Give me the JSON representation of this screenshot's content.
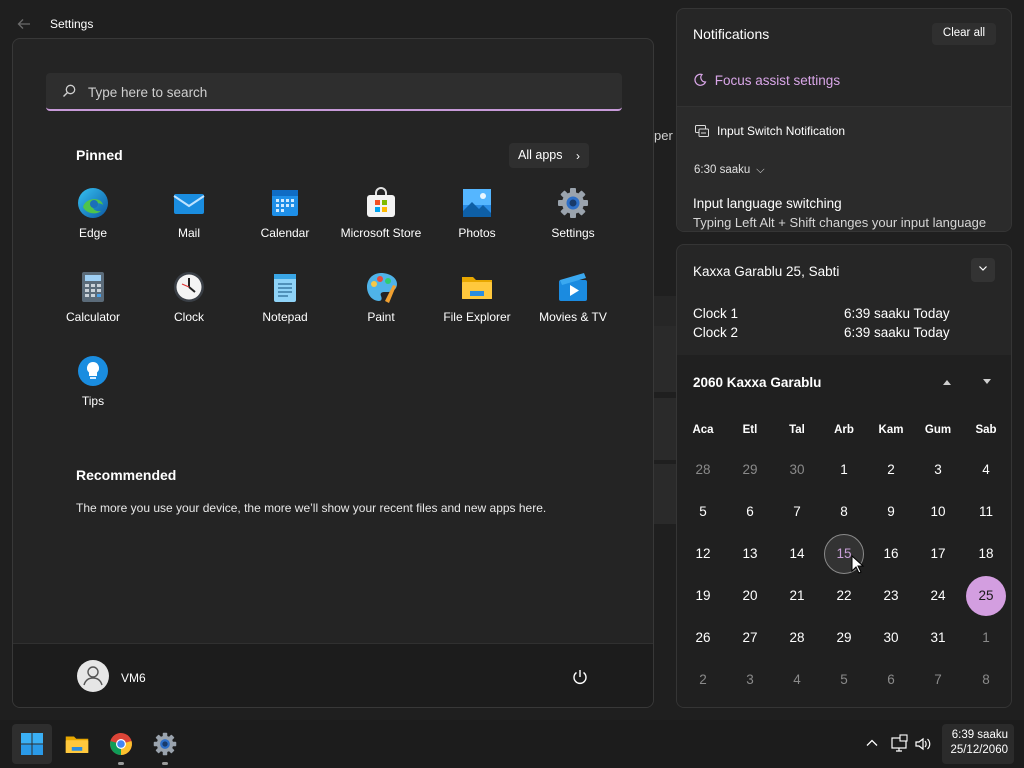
{
  "settings_window": {
    "title": "Settings",
    "peek_text": "per"
  },
  "search": {
    "placeholder": "Type here to search"
  },
  "pinned": {
    "title": "Pinned",
    "all_apps_label": "All apps",
    "apps": [
      {
        "label": "Edge",
        "icon": "edge-icon"
      },
      {
        "label": "Mail",
        "icon": "mail-icon"
      },
      {
        "label": "Calendar",
        "icon": "calendar-icon"
      },
      {
        "label": "Microsoft Store",
        "icon": "store-icon"
      },
      {
        "label": "Photos",
        "icon": "photos-icon"
      },
      {
        "label": "Settings",
        "icon": "gear-icon"
      },
      {
        "label": "Calculator",
        "icon": "calculator-icon"
      },
      {
        "label": "Clock",
        "icon": "clock-icon"
      },
      {
        "label": "Notepad",
        "icon": "notepad-icon"
      },
      {
        "label": "Paint",
        "icon": "paint-icon"
      },
      {
        "label": "File Explorer",
        "icon": "folder-icon"
      },
      {
        "label": "Movies & TV",
        "icon": "movies-icon"
      },
      {
        "label": "Tips",
        "icon": "lightbulb-icon"
      }
    ]
  },
  "recommended": {
    "title": "Recommended",
    "text": "The more you use your device, the more we’ll show your recent files and new apps here."
  },
  "user": {
    "name": "VM6"
  },
  "notifications": {
    "title": "Notifications",
    "clear_all": "Clear all",
    "focus_assist": "Focus assist settings",
    "card": {
      "app": "Input Switch Notification",
      "time": "6:30 saaku",
      "heading": "Input language switching",
      "body": "Typing Left Alt + Shift changes your input language"
    }
  },
  "calendar": {
    "date_header": "Kaxxa Garablu 25, Sabti",
    "clocks": [
      {
        "name": "Clock 1",
        "time": "6:39 saaku Today"
      },
      {
        "name": "Clock 2",
        "time": "6:39 saaku Today"
      }
    ],
    "month_title": "2060 Kaxxa Garablu",
    "weekdays": [
      "Aca",
      "Etl",
      "Tal",
      "Arb",
      "Kam",
      "Gum",
      "Sab"
    ],
    "weeks": [
      [
        "28",
        "29",
        "30",
        "1",
        "2",
        "3",
        "4"
      ],
      [
        "5",
        "6",
        "7",
        "8",
        "9",
        "10",
        "11"
      ],
      [
        "12",
        "13",
        "14",
        "15",
        "16",
        "17",
        "18"
      ],
      [
        "19",
        "20",
        "21",
        "22",
        "23",
        "24",
        "25"
      ],
      [
        "26",
        "27",
        "28",
        "29",
        "30",
        "31",
        "1"
      ],
      [
        "2",
        "3",
        "4",
        "5",
        "6",
        "7",
        "8"
      ]
    ],
    "today": "25",
    "hovered": "15"
  },
  "taskbar": {
    "apps": [
      "start-icon",
      "folder-icon",
      "chrome-icon",
      "gear-icon"
    ],
    "time": "6:39 saaku",
    "date": "25/12/2060"
  },
  "colors": {
    "accent": "#d39ee0",
    "panel": "#262626",
    "start_bg": "#242424"
  }
}
